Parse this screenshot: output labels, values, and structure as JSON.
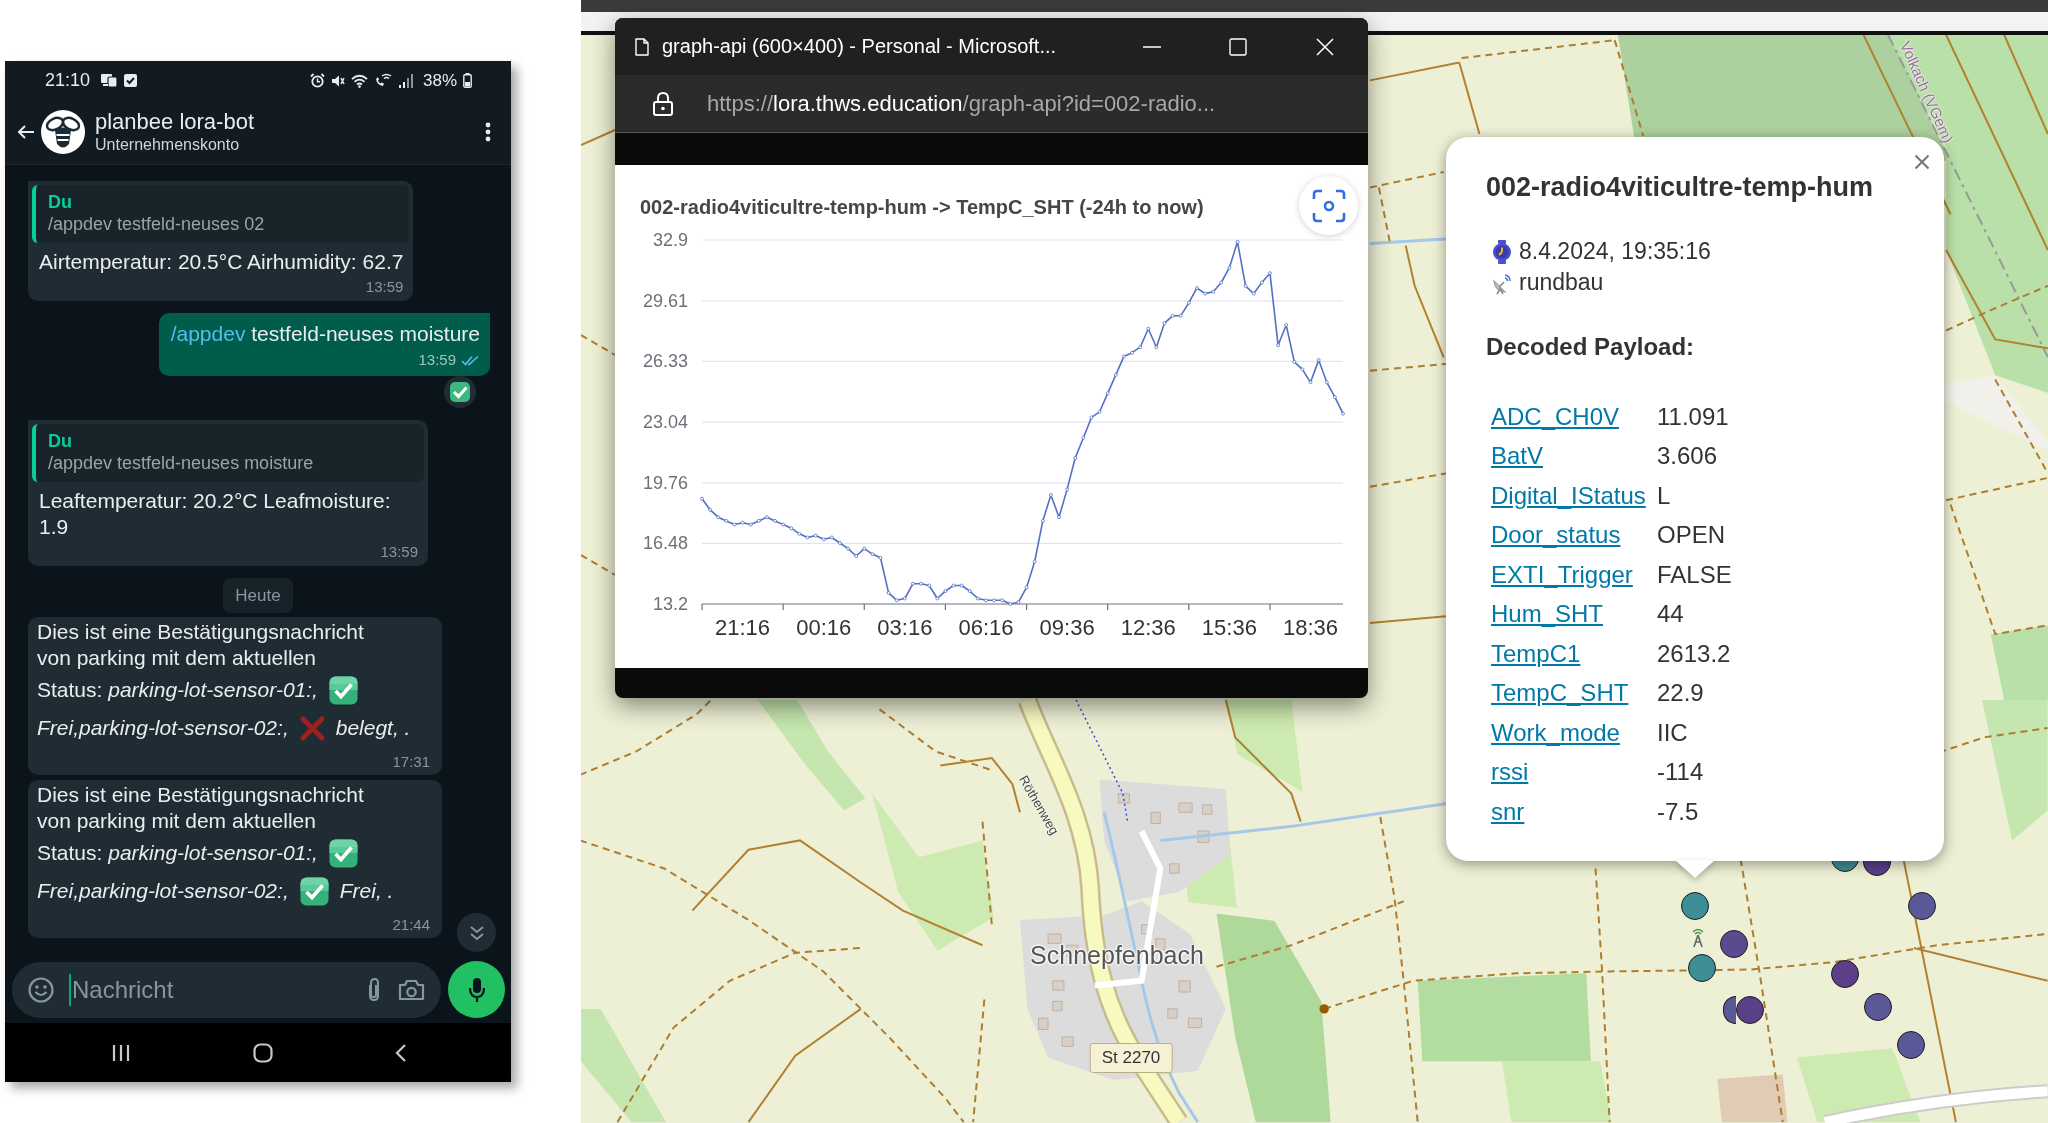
{
  "phone": {
    "status_bar": {
      "time": "21:10",
      "battery": "38%"
    },
    "chat_header": {
      "name": "planbee lora-bot",
      "subtitle": "Unternehmenskonto"
    },
    "messages": [
      {
        "kind": "reply",
        "quote": {
          "author": "Du",
          "text": "/appdev testfeld-neuses 02"
        },
        "text": "Airtemperatur: 20.5°C Airhumidity: 62.7",
        "time": "13:59"
      },
      {
        "kind": "sent",
        "command": "/appdev",
        "text": "testfeld-neuses moisture",
        "time": "13:59",
        "read": true,
        "reacted": true
      },
      {
        "kind": "reply",
        "quote": {
          "author": "Du",
          "text": "/appdev testfeld-neuses moisture"
        },
        "text": "Leaftemperatur: 20.2°C Leafmoisture: 1.9",
        "time": "13:59"
      },
      {
        "kind": "date",
        "text": "Heute"
      },
      {
        "kind": "report",
        "lines": [
          [
            {
              "kind": "text",
              "text": "Dies ist eine Bestätigungsnachricht von parking mit dem aktuellen",
              "italic": false
            }
          ],
          [
            {
              "kind": "text",
              "text": "Status: *parking-lot-sensor-01:,*",
              "italic": false
            },
            {
              "kind": "check"
            }
          ],
          [
            {
              "kind": "text",
              "text": "Frei,parking-lot-sensor-02:,",
              "italic": true
            },
            {
              "kind": "cross"
            },
            {
              "kind": "text",
              "text": "belegt, .",
              "italic": true
            }
          ]
        ],
        "time": "17:31"
      },
      {
        "kind": "report",
        "lines": [
          [
            {
              "kind": "text",
              "text": "Dies ist eine Bestätigungsnachricht von parking mit dem aktuellen",
              "italic": false
            }
          ],
          [
            {
              "kind": "text",
              "text": "Status: *parking-lot-sensor-01:,*",
              "italic": false
            },
            {
              "kind": "check"
            }
          ],
          [
            {
              "kind": "text",
              "text": "Frei,parking-lot-sensor-02:,",
              "italic": true
            },
            {
              "kind": "check"
            },
            {
              "kind": "text",
              "text": "Frei, .",
              "italic": true
            }
          ]
        ],
        "time": "21:44"
      }
    ],
    "composer": {
      "placeholder": "Nachricht"
    }
  },
  "browser_window": {
    "title": "graph-api (600×400) - Personal - Microsoft...",
    "address": {
      "scheme": "https://",
      "host": "lora.thws.education",
      "path": "/graph-api?id=002-radio..."
    },
    "chart_data": {
      "type": "line",
      "title": "002-radio4viticultre-temp-hum -> TempC_SHT (-24h to now)",
      "categories": [
        null,
        null,
        null,
        null,
        null,
        "21:16",
        null,
        null,
        null,
        null,
        null,
        null,
        null,
        null,
        null,
        "00:16",
        null,
        null,
        null,
        null,
        null,
        null,
        null,
        null,
        null,
        "03:16",
        null,
        null,
        null,
        null,
        null,
        null,
        null,
        null,
        null,
        "06:16",
        null,
        null,
        null,
        null,
        null,
        null,
        null,
        null,
        null,
        "09:36",
        null,
        null,
        null,
        null,
        null,
        null,
        null,
        null,
        null,
        "12:36",
        null,
        null,
        null,
        null,
        null,
        null,
        null,
        null,
        null,
        "15:36",
        null,
        null,
        null,
        null,
        null,
        null,
        null,
        null,
        null,
        "18:36",
        null,
        null,
        null,
        null
      ],
      "series": [
        {
          "color": "#5470c6",
          "marker": "circle",
          "values": [
            18.9,
            18.3,
            17.9,
            17.7,
            17.5,
            17.6,
            17.5,
            17.7,
            17.9,
            17.7,
            17.5,
            17.3,
            17.0,
            16.8,
            16.9,
            16.7,
            16.8,
            16.5,
            16.2,
            15.8,
            16.2,
            15.9,
            15.7,
            13.8,
            13.4,
            13.5,
            14.3,
            14.3,
            14.2,
            13.5,
            13.9,
            14.2,
            14.2,
            13.9,
            13.5,
            13.4,
            13.4,
            13.4,
            13.2,
            13.3,
            14.1,
            15.5,
            17.7,
            19.1,
            17.9,
            19.4,
            21.1,
            22.2,
            23.3,
            23.6,
            24.6,
            25.6,
            26.6,
            26.8,
            27.1,
            28.1,
            27.1,
            28.4,
            28.8,
            28.8,
            29.5,
            30.3,
            30.0,
            30.1,
            30.6,
            31.4,
            32.8,
            30.4,
            30.0,
            30.6,
            31.1,
            27.2,
            28.3,
            26.3,
            25.9,
            25.2,
            26.4,
            25.2,
            24.4,
            23.5
          ]
        }
      ],
      "ylim": [
        13.2,
        32.9
      ],
      "yticks": [
        13.2,
        16.48,
        19.76,
        23.04,
        26.33,
        29.61,
        32.9
      ],
      "grid": true
    }
  },
  "map": {
    "labels": [
      {
        "kind": "district",
        "text": "Volkach (VGem)"
      },
      {
        "kind": "street",
        "text": "Röthenweg"
      },
      {
        "kind": "place",
        "text": "Schnepfenbach"
      },
      {
        "kind": "road",
        "text": "St 2270"
      }
    ],
    "markers": [
      {
        "color": "#3e8e97"
      },
      {
        "color": "#5b3f89"
      },
      {
        "color": "#3e8e97"
      },
      {
        "color": "#5a5897"
      },
      {
        "color": "#5b4a90"
      },
      {
        "color": "#3e8e97"
      },
      {
        "color": "#5b3f89"
      },
      {
        "color": "#5a5897"
      },
      {
        "color": "#5a5897"
      },
      {
        "color": "#5b3f89"
      },
      {
        "color": "#5a5897"
      }
    ]
  },
  "popup": {
    "title": "002-radio4viticultre-temp-hum",
    "timestamp": "8.4.2024, 19:35:16",
    "gateway": "rundbau",
    "section_title": "Decoded Payload:",
    "fields": [
      {
        "key": "ADC_CH0V",
        "value": "11.091"
      },
      {
        "key": "BatV",
        "value": "3.606"
      },
      {
        "key": "Digital_IStatus",
        "value": "L"
      },
      {
        "key": "Door_status",
        "value": "OPEN"
      },
      {
        "key": "EXTI_Trigger",
        "value": "FALSE"
      },
      {
        "key": "Hum_SHT",
        "value": "44"
      },
      {
        "key": "TempC1",
        "value": "2613.2"
      },
      {
        "key": "TempC_SHT",
        "value": "22.9"
      },
      {
        "key": "Work_mode",
        "value": "IIC"
      },
      {
        "key": "rssi",
        "value": "-114"
      },
      {
        "key": "snr",
        "value": "-7.5"
      }
    ]
  }
}
